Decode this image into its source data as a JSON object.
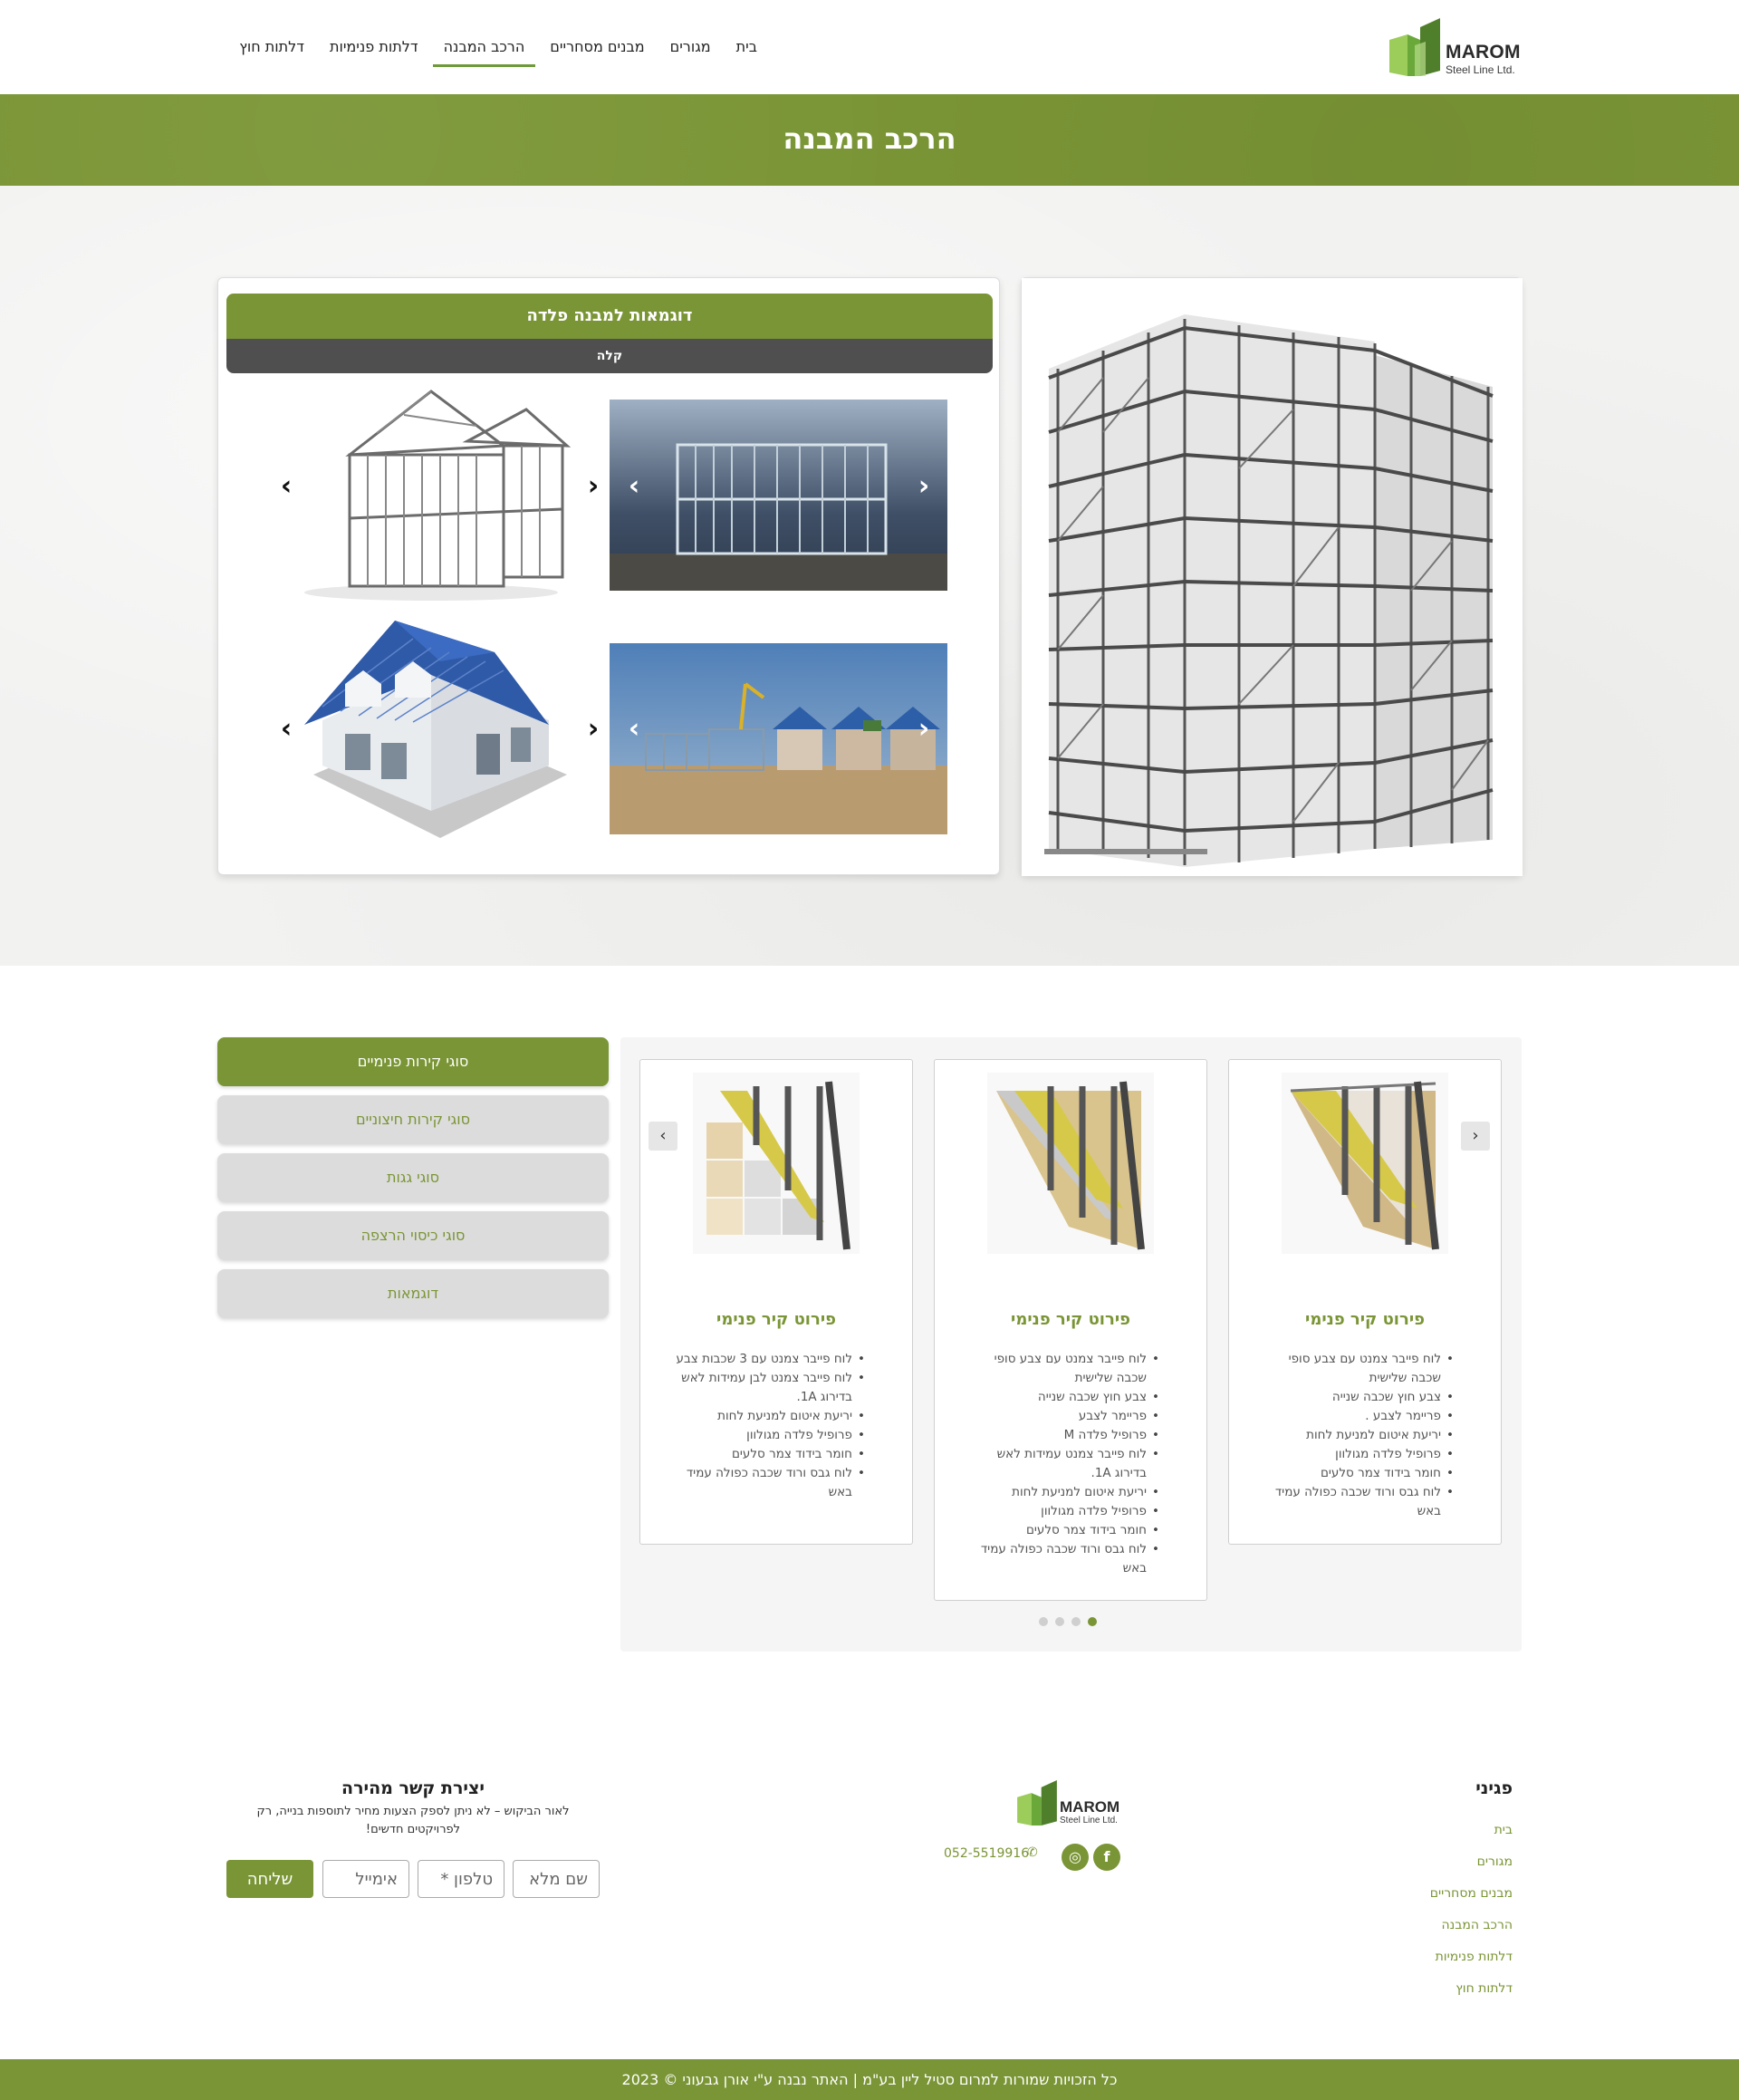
{
  "brand": {
    "name": "MAROM",
    "sub": "Steel Line Ltd.",
    "green": "#7a9535",
    "dark": "#4f4f4f"
  },
  "nav": {
    "items": [
      {
        "label": "בית",
        "icon": ""
      },
      {
        "label": "מגורים"
      },
      {
        "label": "מבנים מסחריים"
      },
      {
        "label": "הרכב המבנה",
        "active": true
      },
      {
        "label": "דלתות פנימיות"
      },
      {
        "label": "דלתות חוץ"
      }
    ]
  },
  "page_title": "הרכב המבנה",
  "examples": {
    "title": "דוגמאות למבנה פלדה",
    "subtitle": "קלה",
    "images": [
      "steel-frame-house-render",
      "steel-frame-construction-photo",
      "finished-house-render",
      "houses-site-photo"
    ]
  },
  "building_image": "steel-frame-tower-render",
  "tabs": [
    {
      "label": "סוגי קירות פנימיים",
      "active": true
    },
    {
      "label": "סוגי קירות חיצוניים"
    },
    {
      "label": "סוגי גגות"
    },
    {
      "label": "סוגי כיסוי הרצפה"
    },
    {
      "label": "דוגמאות"
    }
  ],
  "walls": [
    {
      "title": "פירוט קיר פנימי",
      "items": [
        "לוח פייבר צמנט עם צבע סופי שכבה שלישית",
        "צבע חוץ שכבה שנייה",
        "פריימר לצבע .",
        "יריעת איטום למניעת לחות",
        "פרופיל פלדה מגולוון",
        "חומר בידוד צמר סלעים",
        "לוח גבס ורוד שכבה כפולה עמיד באש"
      ]
    },
    {
      "title": "פירוט קיר פנימי",
      "items": [
        "לוח פייבר צמנט עם צבע סופי שכבה שלישית",
        "צבע חוץ שכבה שנייה",
        "פריימר לצבע",
        "פרופיל פלדה M",
        "לוח פייבר צמנט עמידות לאש בדירוג 1A.",
        "יריעת איטום למניעת לחות",
        "פרופיל פלדה מגולוון",
        "חומר בידוד צמר סלעים",
        "לוח גבס ורוד שכבה כפולה עמיד באש"
      ]
    },
    {
      "title": "פירוט קיר פנימי",
      "items": [
        "לוח פייבר צמנט עם 3 שכבות צבע",
        "לוח פייבר צמנט לבן עמידות לאש בדירוג 1A.",
        "יריעת איטום למניעת לחות",
        "פרופיל פלדה מגולוון",
        "חומר בידוד צמר סלעים",
        "לוח גבס ורוד שכבה כפולה עמיד באש"
      ]
    }
  ],
  "slider": {
    "prev": "‹",
    "next": "›",
    "dots": 4,
    "active_dot": 4
  },
  "footer": {
    "pages_title": "פגיני",
    "links": [
      "בית",
      "מגורים",
      "מבנים מסחריים",
      "הרכב המבנה",
      "דלתות פנימיות",
      "דלתות חוץ"
    ],
    "phone": "052-5519916",
    "social": [
      {
        "icon": "facebook-icon",
        "glyph": "f"
      },
      {
        "icon": "instagram-icon",
        "glyph": "◎"
      }
    ],
    "contact": {
      "title": "יצירת קשר מהירה",
      "text": "לאור הביקוש – לא ניתן לספק הצעות מחיר לתוספות בנייה, רק לפרויקטים חדשים!",
      "name_ph": "שם מלא",
      "phone_ph": "טלפון *",
      "email_ph": "אימייל",
      "submit": "שליחה"
    },
    "copyright": "2023 © כל הזכויות שמורות למרום סטיל ליין בע\"מ | האתר נבנה ע\"י אורן גבעוני"
  }
}
